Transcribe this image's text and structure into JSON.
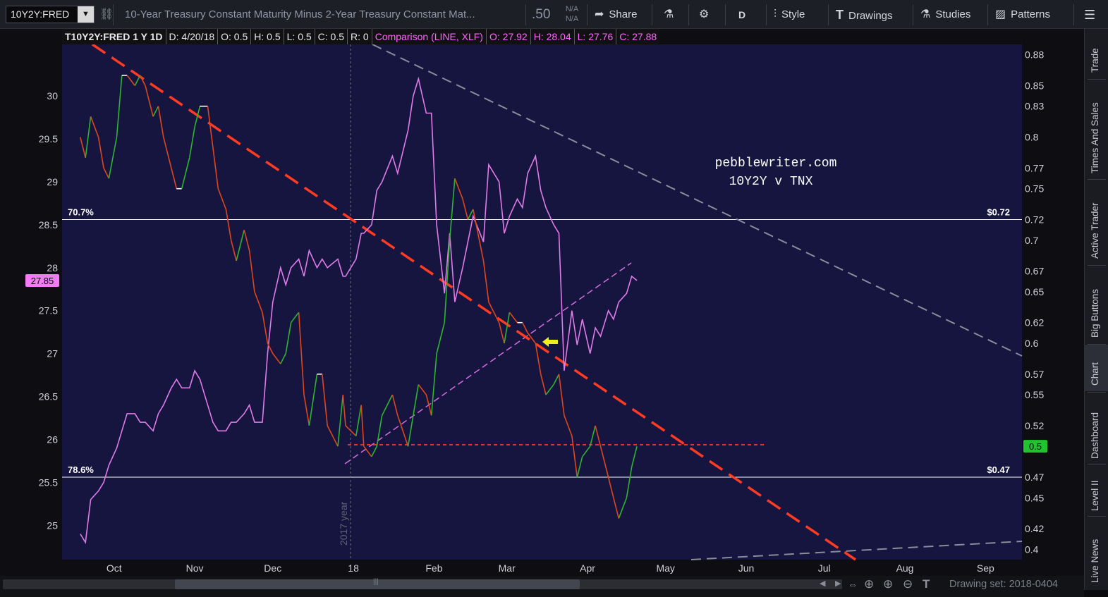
{
  "toolbar": {
    "symbol": "10Y2Y:FRED",
    "description": "10-Year Treasury Constant Maturity Minus 2-Year Treasury Constant Mat...",
    "price": ".50",
    "na_top": "N/A",
    "na_bottom": "N/A",
    "share_label": "Share",
    "timeframe_label": "D",
    "style_label": "Style",
    "drawings_label": "Drawings",
    "studies_label": "Studies",
    "patterns_label": "Patterns"
  },
  "infobar": {
    "symbol_period": "T10Y2Y:FRED 1 Y 1D",
    "date": "D: 4/20/18",
    "open": "O: 0.5",
    "high": "H: 0.5",
    "low": "L: 0.5",
    "close": "C: 0.5",
    "range": "R: 0",
    "comparison": "Comparison (LINE, XLF)",
    "cmp_open": "O: 27.92",
    "cmp_high": "H: 28.04",
    "cmp_low": "L: 27.76",
    "cmp_close": "C: 27.88"
  },
  "chart_data": {
    "type": "line",
    "x_ticks": [
      "Oct",
      "Nov",
      "Dec",
      "18",
      "Feb",
      "Mar",
      "Apr",
      "May",
      "Jun",
      "Jul",
      "Aug",
      "Sep"
    ],
    "left_axis_ticks": [
      "30",
      "29.5",
      "29",
      "28.5",
      "28",
      "27.5",
      "27",
      "26.5",
      "26",
      "25.5",
      "25"
    ],
    "right_axis_ticks": [
      "0.88",
      "0.85",
      "0.83",
      "0.8",
      "0.77",
      "0.75",
      "0.72",
      "0.7",
      "0.67",
      "0.65",
      "0.62",
      "0.6",
      "0.57",
      "0.55",
      "0.52",
      "0.5",
      "0.47",
      "0.45",
      "0.42",
      "0.4"
    ],
    "left_ylim": [
      24.6,
      30.6
    ],
    "right_ylim": [
      0.39,
      0.89
    ],
    "left_price_tag": "27.85",
    "right_price_tag": "0.5",
    "fib_levels": [
      {
        "label": "70.7%",
        "value_label": "$0.72",
        "value": 0.72
      },
      {
        "label": "78.6%",
        "value_label": "$0.47",
        "value": 0.47
      }
    ],
    "year_marker_label": "2017 year",
    "annotation_lines": [
      "pebblewriter.com",
      "10Y2Y v TNX"
    ],
    "colors": {
      "background": "#151540",
      "price_up": "#2db52d",
      "price_down": "#e0461a",
      "comparison": "#e07be8",
      "trendline": "#ff3b22",
      "resistance": "#8a8c9a",
      "support_dashed": "#ff3b22",
      "arrow": "#f0ee22",
      "fib_line": "#ffffff"
    },
    "series": [
      {
        "name": "T10Y2Y:FRED",
        "axis": "right",
        "points": [
          [
            "2017-09-18",
            0.8
          ],
          [
            "2017-09-20",
            0.78
          ],
          [
            "2017-09-22",
            0.82
          ],
          [
            "2017-09-25",
            0.8
          ],
          [
            "2017-09-27",
            0.77
          ],
          [
            "2017-09-29",
            0.76
          ],
          [
            "2017-10-02",
            0.8
          ],
          [
            "2017-10-04",
            0.86
          ],
          [
            "2017-10-06",
            0.86
          ],
          [
            "2017-10-09",
            0.85
          ],
          [
            "2017-10-11",
            0.86
          ],
          [
            "2017-10-13",
            0.85
          ],
          [
            "2017-10-16",
            0.82
          ],
          [
            "2017-10-18",
            0.83
          ],
          [
            "2017-10-20",
            0.8
          ],
          [
            "2017-10-23",
            0.77
          ],
          [
            "2017-10-25",
            0.75
          ],
          [
            "2017-10-27",
            0.75
          ],
          [
            "2017-10-30",
            0.78
          ],
          [
            "2017-11-01",
            0.81
          ],
          [
            "2017-11-03",
            0.83
          ],
          [
            "2017-11-06",
            0.83
          ],
          [
            "2017-11-08",
            0.79
          ],
          [
            "2017-11-10",
            0.75
          ],
          [
            "2017-11-13",
            0.73
          ],
          [
            "2017-11-15",
            0.7
          ],
          [
            "2017-11-17",
            0.68
          ],
          [
            "2017-11-20",
            0.71
          ],
          [
            "2017-11-22",
            0.69
          ],
          [
            "2017-11-24",
            0.65
          ],
          [
            "2017-11-27",
            0.63
          ],
          [
            "2017-11-29",
            0.6
          ],
          [
            "2017-12-01",
            0.59
          ],
          [
            "2017-12-04",
            0.58
          ],
          [
            "2017-12-06",
            0.59
          ],
          [
            "2017-12-08",
            0.62
          ],
          [
            "2017-12-11",
            0.63
          ],
          [
            "2017-12-13",
            0.55
          ],
          [
            "2017-12-15",
            0.52
          ],
          [
            "2017-12-18",
            0.57
          ],
          [
            "2017-12-20",
            0.57
          ],
          [
            "2017-12-22",
            0.52
          ],
          [
            "2017-12-26",
            0.5
          ],
          [
            "2017-12-28",
            0.55
          ],
          [
            "2017-12-29",
            0.52
          ],
          [
            "2018-01-02",
            0.51
          ],
          [
            "2018-01-04",
            0.54
          ],
          [
            "2018-01-05",
            0.5
          ],
          [
            "2018-01-08",
            0.49
          ],
          [
            "2018-01-10",
            0.5
          ],
          [
            "2018-01-12",
            0.53
          ],
          [
            "2018-01-16",
            0.55
          ],
          [
            "2018-01-18",
            0.53
          ],
          [
            "2018-01-22",
            0.5
          ],
          [
            "2018-01-24",
            0.53
          ],
          [
            "2018-01-26",
            0.56
          ],
          [
            "2018-01-29",
            0.55
          ],
          [
            "2018-01-31",
            0.53
          ],
          [
            "2018-02-02",
            0.59
          ],
          [
            "2018-02-05",
            0.62
          ],
          [
            "2018-02-07",
            0.7
          ],
          [
            "2018-02-09",
            0.76
          ],
          [
            "2018-02-12",
            0.74
          ],
          [
            "2018-02-14",
            0.72
          ],
          [
            "2018-02-16",
            0.73
          ],
          [
            "2018-02-20",
            0.68
          ],
          [
            "2018-02-22",
            0.64
          ],
          [
            "2018-02-26",
            0.62
          ],
          [
            "2018-02-28",
            0.6
          ],
          [
            "2018-03-02",
            0.63
          ],
          [
            "2018-03-05",
            0.62
          ],
          [
            "2018-03-07",
            0.62
          ],
          [
            "2018-03-09",
            0.61
          ],
          [
            "2018-03-12",
            0.6
          ],
          [
            "2018-03-14",
            0.57
          ],
          [
            "2018-03-16",
            0.55
          ],
          [
            "2018-03-19",
            0.56
          ],
          [
            "2018-03-21",
            0.57
          ],
          [
            "2018-03-23",
            0.53
          ],
          [
            "2018-03-26",
            0.51
          ],
          [
            "2018-03-28",
            0.47
          ],
          [
            "2018-03-30",
            0.49
          ],
          [
            "2018-04-02",
            0.5
          ],
          [
            "2018-04-04",
            0.52
          ],
          [
            "2018-04-06",
            0.5
          ],
          [
            "2018-04-09",
            0.47
          ],
          [
            "2018-04-11",
            0.45
          ],
          [
            "2018-04-13",
            0.43
          ],
          [
            "2018-04-16",
            0.45
          ],
          [
            "2018-04-18",
            0.48
          ],
          [
            "2018-04-20",
            0.5
          ]
        ]
      },
      {
        "name": "XLF",
        "axis": "left",
        "points": [
          [
            "2017-09-18",
            24.9
          ],
          [
            "2017-09-20",
            24.8
          ],
          [
            "2017-09-22",
            25.3
          ],
          [
            "2017-09-25",
            25.4
          ],
          [
            "2017-09-27",
            25.5
          ],
          [
            "2017-09-29",
            25.7
          ],
          [
            "2017-10-02",
            25.9
          ],
          [
            "2017-10-04",
            26.1
          ],
          [
            "2017-10-06",
            26.3
          ],
          [
            "2017-10-09",
            26.3
          ],
          [
            "2017-10-11",
            26.2
          ],
          [
            "2017-10-13",
            26.2
          ],
          [
            "2017-10-16",
            26.1
          ],
          [
            "2017-10-18",
            26.3
          ],
          [
            "2017-10-20",
            26.4
          ],
          [
            "2017-10-23",
            26.6
          ],
          [
            "2017-10-25",
            26.7
          ],
          [
            "2017-10-27",
            26.6
          ],
          [
            "2017-10-30",
            26.6
          ],
          [
            "2017-11-01",
            26.8
          ],
          [
            "2017-11-03",
            26.7
          ],
          [
            "2017-11-06",
            26.4
          ],
          [
            "2017-11-08",
            26.2
          ],
          [
            "2017-11-10",
            26.1
          ],
          [
            "2017-11-13",
            26.1
          ],
          [
            "2017-11-15",
            26.2
          ],
          [
            "2017-11-17",
            26.2
          ],
          [
            "2017-11-20",
            26.3
          ],
          [
            "2017-11-22",
            26.4
          ],
          [
            "2017-11-24",
            26.2
          ],
          [
            "2017-11-27",
            26.2
          ],
          [
            "2017-11-29",
            27.0
          ],
          [
            "2017-12-01",
            27.6
          ],
          [
            "2017-12-04",
            28.0
          ],
          [
            "2017-12-06",
            27.8
          ],
          [
            "2017-12-08",
            28.0
          ],
          [
            "2017-12-11",
            28.1
          ],
          [
            "2017-12-13",
            27.9
          ],
          [
            "2017-12-15",
            28.2
          ],
          [
            "2017-12-18",
            28.0
          ],
          [
            "2017-12-20",
            28.1
          ],
          [
            "2017-12-22",
            28.0
          ],
          [
            "2017-12-26",
            28.1
          ],
          [
            "2017-12-28",
            27.9
          ],
          [
            "2017-12-29",
            27.9
          ],
          [
            "2018-01-02",
            28.1
          ],
          [
            "2018-01-04",
            28.4
          ],
          [
            "2018-01-05",
            28.4
          ],
          [
            "2018-01-08",
            28.5
          ],
          [
            "2018-01-10",
            28.9
          ],
          [
            "2018-01-12",
            29.0
          ],
          [
            "2018-01-16",
            29.3
          ],
          [
            "2018-01-18",
            29.1
          ],
          [
            "2018-01-22",
            29.6
          ],
          [
            "2018-01-24",
            30.0
          ],
          [
            "2018-01-26",
            30.2
          ],
          [
            "2018-01-29",
            29.8
          ],
          [
            "2018-01-31",
            29.8
          ],
          [
            "2018-02-02",
            28.5
          ],
          [
            "2018-02-05",
            27.7
          ],
          [
            "2018-02-07",
            28.4
          ],
          [
            "2018-02-09",
            27.6
          ],
          [
            "2018-02-12",
            28.0
          ],
          [
            "2018-02-14",
            28.3
          ],
          [
            "2018-02-16",
            28.6
          ],
          [
            "2018-02-20",
            28.3
          ],
          [
            "2018-02-22",
            29.2
          ],
          [
            "2018-02-26",
            29.0
          ],
          [
            "2018-02-28",
            28.4
          ],
          [
            "2018-03-02",
            28.6
          ],
          [
            "2018-03-05",
            28.8
          ],
          [
            "2018-03-07",
            28.7
          ],
          [
            "2018-03-09",
            29.1
          ],
          [
            "2018-03-12",
            29.3
          ],
          [
            "2018-03-14",
            28.9
          ],
          [
            "2018-03-16",
            28.7
          ],
          [
            "2018-03-19",
            28.5
          ],
          [
            "2018-03-21",
            28.4
          ],
          [
            "2018-03-23",
            26.8
          ],
          [
            "2018-03-26",
            27.5
          ],
          [
            "2018-03-28",
            27.1
          ],
          [
            "2018-03-30",
            27.4
          ],
          [
            "2018-04-02",
            27.0
          ],
          [
            "2018-04-04",
            27.3
          ],
          [
            "2018-04-06",
            27.2
          ],
          [
            "2018-04-09",
            27.5
          ],
          [
            "2018-04-11",
            27.4
          ],
          [
            "2018-04-13",
            27.6
          ],
          [
            "2018-04-16",
            27.7
          ],
          [
            "2018-04-18",
            27.9
          ],
          [
            "2018-04-20",
            27.85
          ]
        ]
      }
    ]
  },
  "sidetabs": [
    "Trade",
    "Times And Sales",
    "Active Trader",
    "Big Buttons",
    "Chart",
    "Dashboard",
    "Level II",
    "Live News"
  ],
  "bottom": {
    "drawing_set": "Drawing set: 2018-0404"
  }
}
